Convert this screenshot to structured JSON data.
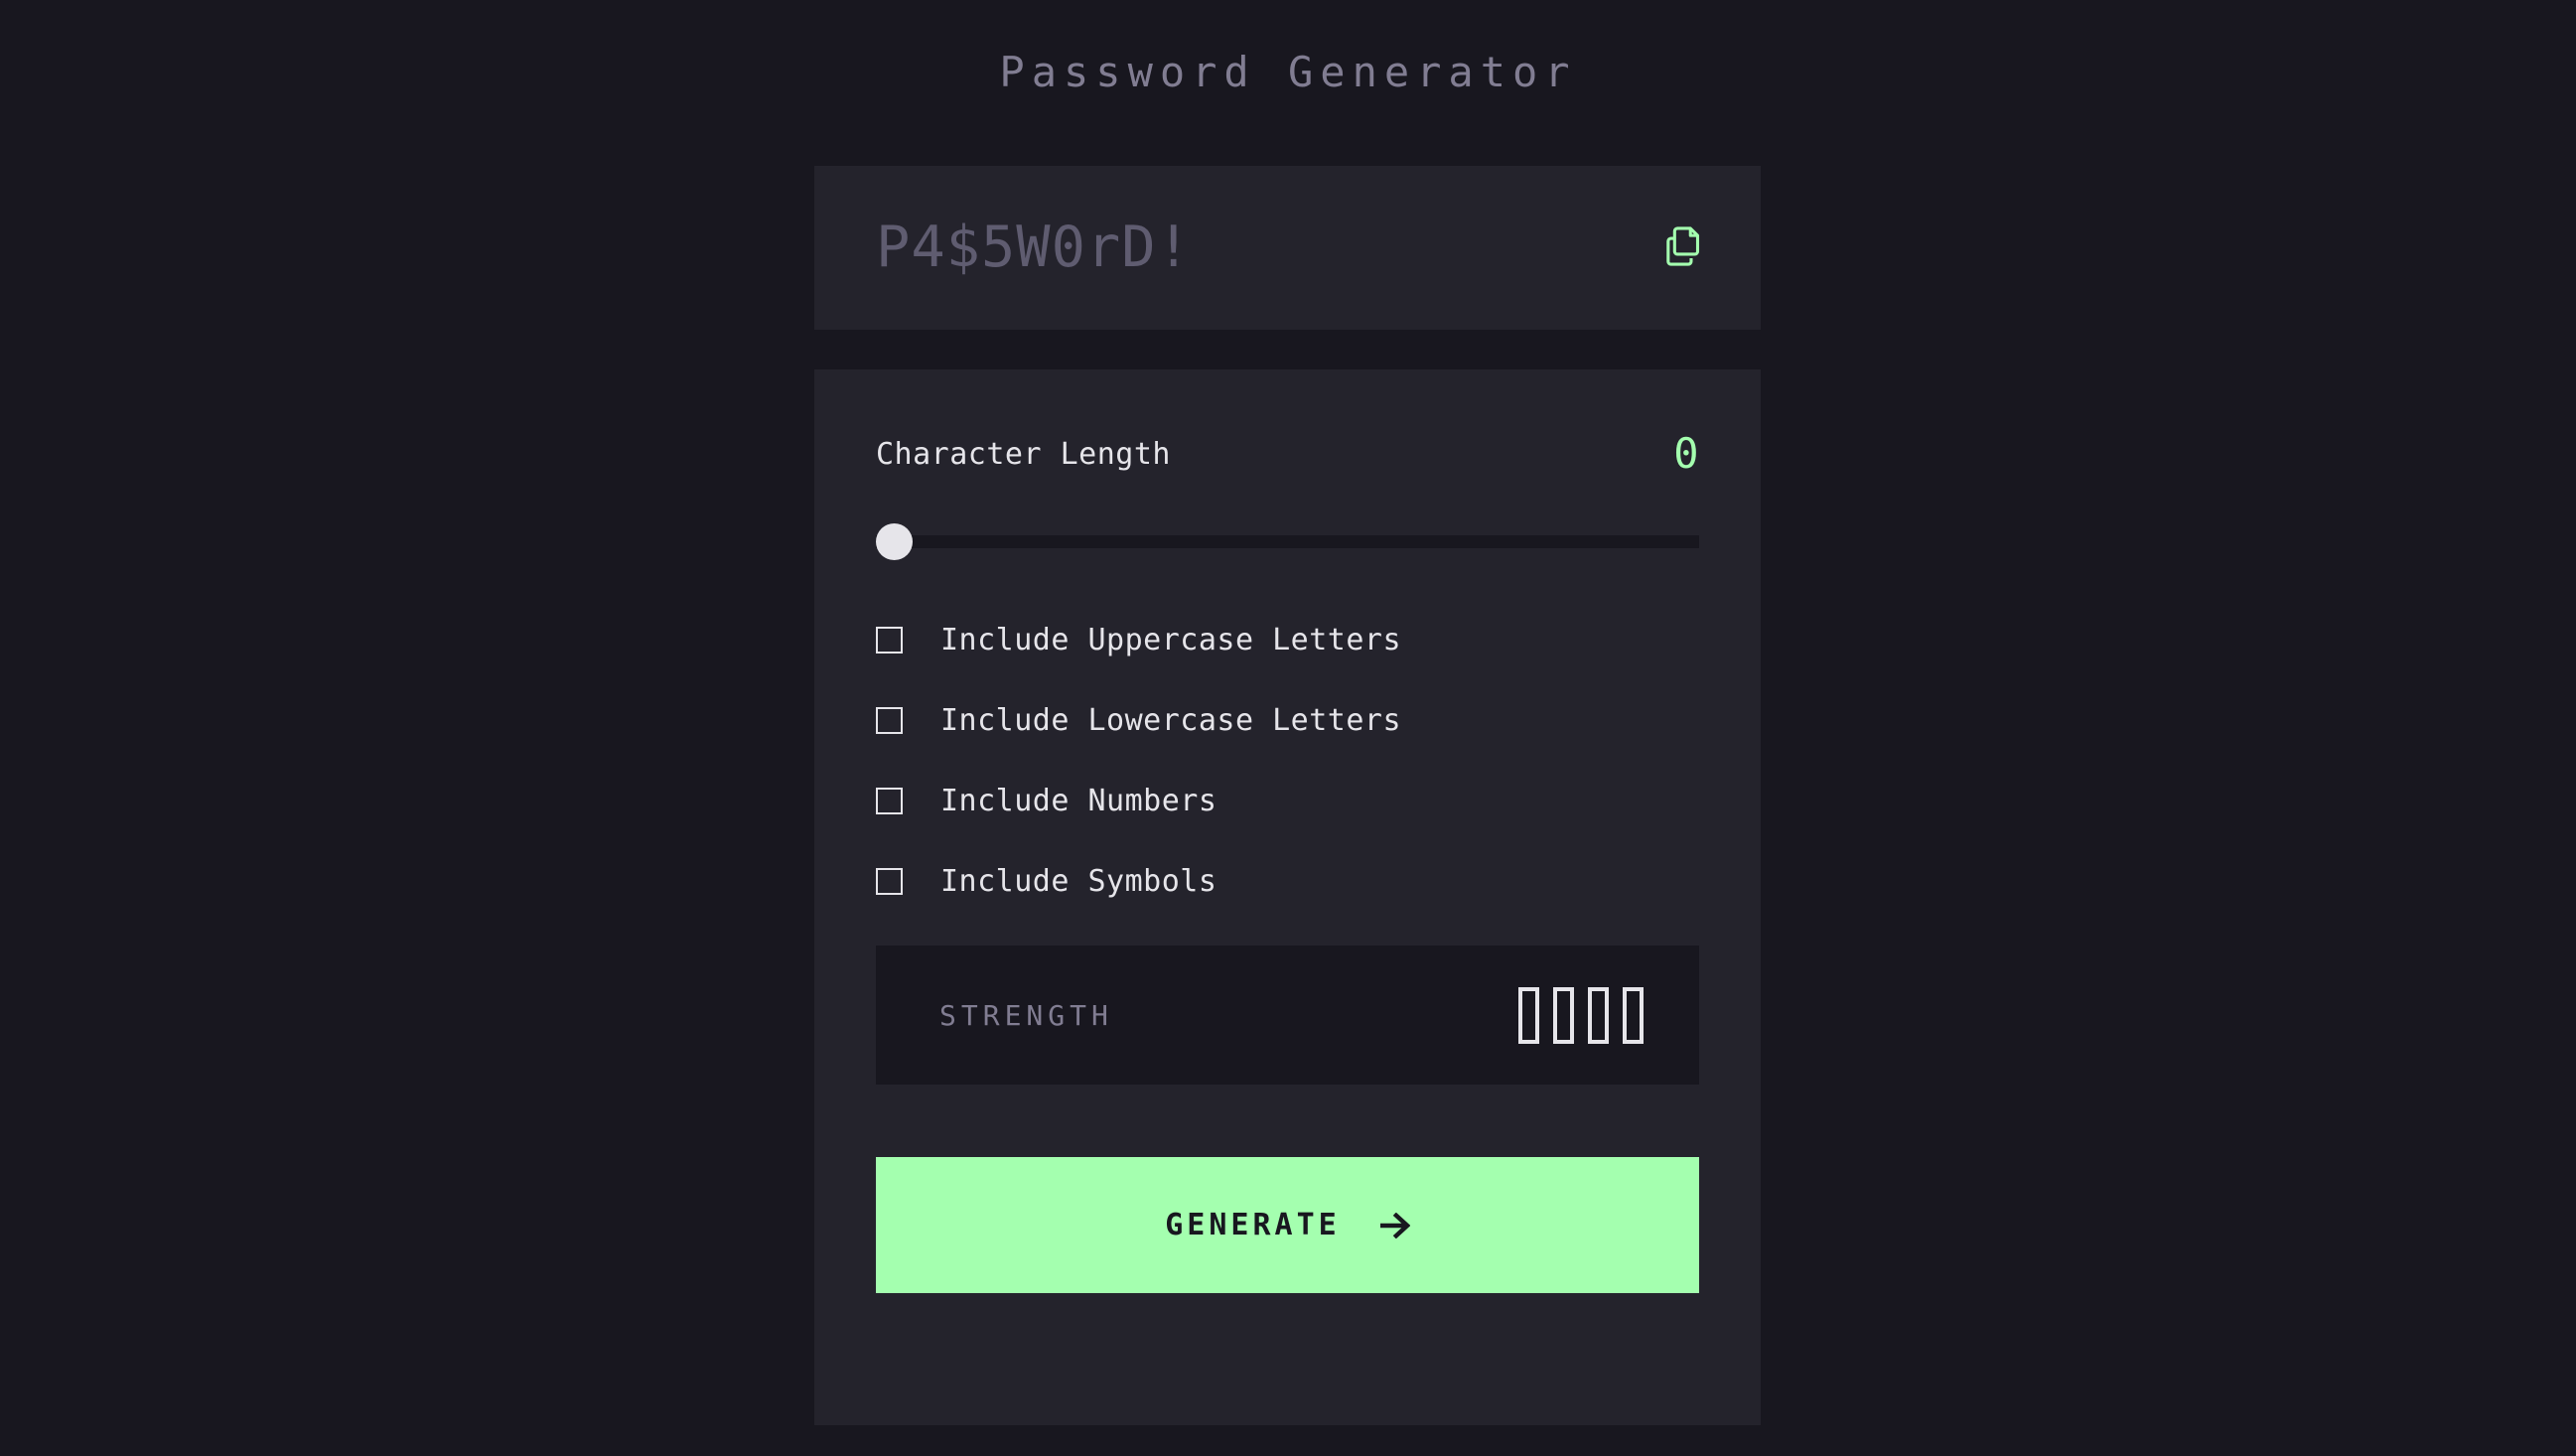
{
  "page": {
    "title": "Password Generator",
    "background_color": "#18171F",
    "card_color": "#24232C",
    "accent_color": "#A4FFAF",
    "text_color": "#E6E5EA",
    "muted_text_color": "#817D92"
  },
  "password_display": {
    "value": "P4$5W0rD!",
    "is_placeholder": true,
    "copy_icon": "copy-icon",
    "copy_icon_color": "#A4FFAF"
  },
  "character_length": {
    "label": "Character Length",
    "value": "0",
    "value_color": "#A4FFAF",
    "slider": {
      "min": 0,
      "max": 20,
      "current": 0,
      "fill_percent": 0,
      "thumb_color": "#E6E5EA",
      "track_color": "#18171F"
    }
  },
  "options": [
    {
      "id": "uppercase",
      "label": "Include Uppercase Letters",
      "checked": false
    },
    {
      "id": "lowercase",
      "label": "Include Lowercase Letters",
      "checked": false
    },
    {
      "id": "numbers",
      "label": "Include Numbers",
      "checked": false
    },
    {
      "id": "symbols",
      "label": "Include Symbols",
      "checked": false
    }
  ],
  "strength": {
    "label": "STRENGTH",
    "rating": "",
    "bars_total": 4,
    "bars_filled": 0,
    "bar_outline_color": "#E6E5EA"
  },
  "generate": {
    "label": "GENERATE",
    "arrow_icon": "arrow-right-icon",
    "background_color": "#A4FFAF",
    "text_color": "#18171F"
  }
}
